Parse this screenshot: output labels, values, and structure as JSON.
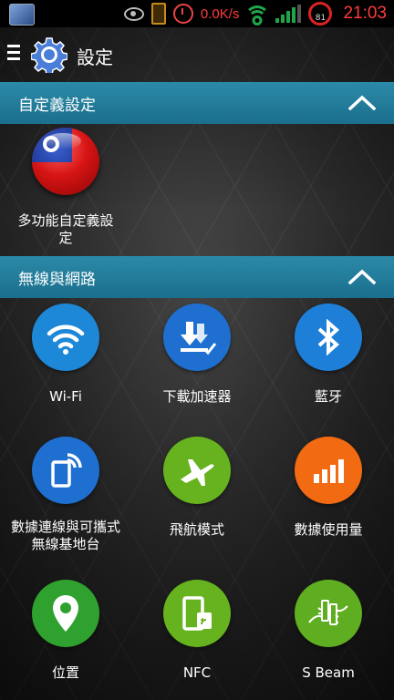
{
  "status_bar": {
    "network_speed": "0.0K/s",
    "battery_level": "81",
    "time": "21:03",
    "icons": [
      "photo-icon",
      "eye-icon",
      "vibrate-icon",
      "alarm-icon",
      "wifi-icon",
      "signal-icon",
      "battery-icon"
    ]
  },
  "action_bar": {
    "title": "設定",
    "icons": [
      "menu-icon",
      "gear-icon"
    ]
  },
  "sections": [
    {
      "title": "自定義設定",
      "items": [
        {
          "label": "多功能自定義設定",
          "icon": "taiwan-flag-icon"
        }
      ]
    },
    {
      "title": "無線與網路",
      "items": [
        {
          "label": "Wi-Fi",
          "icon": "wifi-icon",
          "color": "#1e88d8"
        },
        {
          "label": "下載加速器",
          "icon": "download-icon",
          "color": "#1e6fd0"
        },
        {
          "label": "藍牙",
          "icon": "bluetooth-icon",
          "color": "#1e7fd8"
        },
        {
          "label": "數據連線與可攜式無線基地台",
          "icon": "hotspot-icon",
          "color": "#1e6fd0"
        },
        {
          "label": "飛航模式",
          "icon": "airplane-icon",
          "color": "#66b21f"
        },
        {
          "label": "數據使用量",
          "icon": "data-usage-icon",
          "color": "#f26a12"
        },
        {
          "label": "位置",
          "icon": "location-icon",
          "color": "#2ea12f"
        },
        {
          "label": "NFC",
          "icon": "nfc-icon",
          "color": "#66b21f"
        },
        {
          "label": "S Beam",
          "icon": "s-beam-icon",
          "color": "#5fae21"
        }
      ]
    }
  ]
}
